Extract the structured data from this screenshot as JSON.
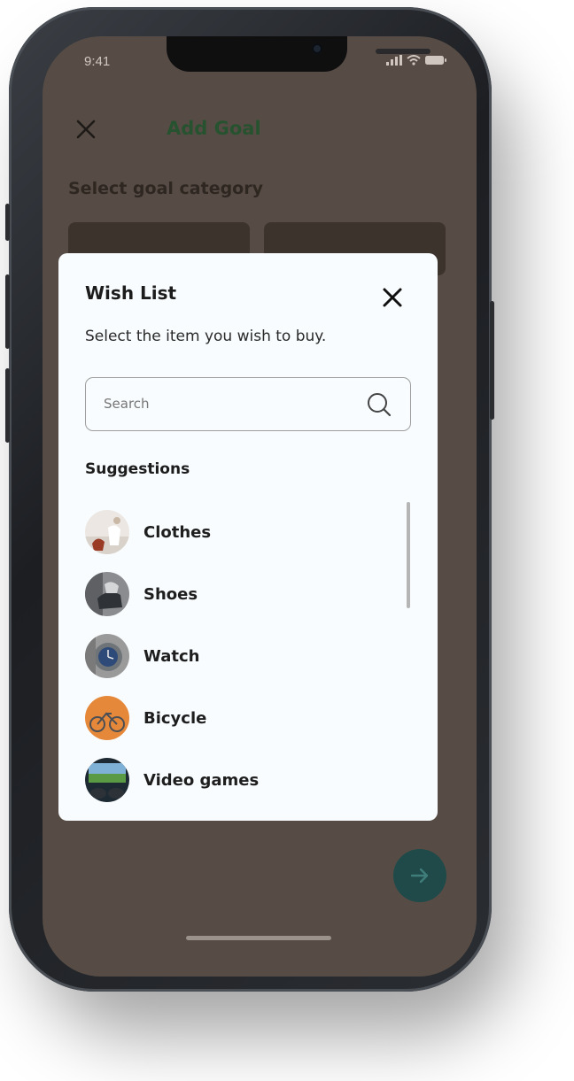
{
  "status_bar": {
    "time": "9:41"
  },
  "header": {
    "title": "Add Goal",
    "close_icon": "close-icon"
  },
  "section": {
    "title": "Select goal category"
  },
  "modal": {
    "title": "Wish List",
    "subtitle": "Select the item you wish to buy.",
    "search": {
      "placeholder": "Search",
      "icon": "search-icon"
    },
    "suggestions_title": "Suggestions",
    "items": [
      {
        "label": "Clothes",
        "icon": "clothes-thumbnail"
      },
      {
        "label": "Shoes",
        "icon": "shoes-thumbnail"
      },
      {
        "label": "Watch",
        "icon": "watch-thumbnail"
      },
      {
        "label": "Bicycle",
        "icon": "bicycle-thumbnail"
      },
      {
        "label": "Video games",
        "icon": "video-games-thumbnail"
      }
    ]
  },
  "next_button": {
    "icon": "arrow-right-icon"
  },
  "colors": {
    "screen_background": "#574c45",
    "accent_title": "#27522f",
    "modal_background": "#f8fcfe",
    "next_button": "#1f4a49"
  }
}
